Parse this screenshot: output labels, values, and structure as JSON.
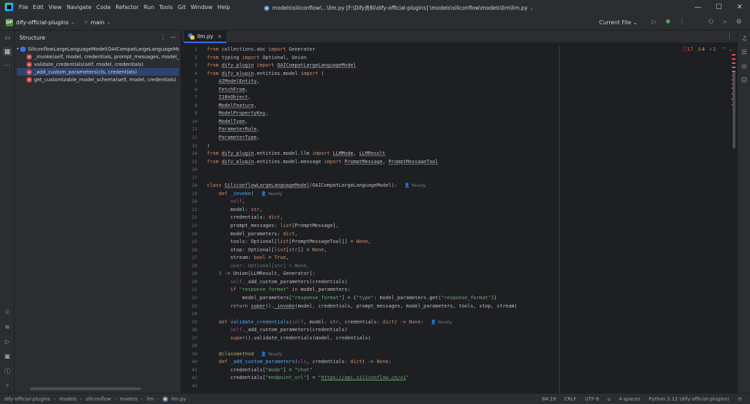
{
  "menu": [
    "File",
    "Edit",
    "View",
    "Navigate",
    "Code",
    "Refactor",
    "Run",
    "Tools",
    "Git",
    "Window",
    "Help"
  ],
  "project": {
    "badge": "DP",
    "name": "dify-official-plugins",
    "branch": "main"
  },
  "file_path": "models\\siliconflow\\...\\llm.py [F:\\Dify资料\\dify-official-plugins] \\models\\siliconflow\\models\\llm\\llm.py",
  "run_config": "Current File",
  "structure": {
    "title": "Structure",
    "items": [
      {
        "label": "SiliconflowLargeLanguageModel(OAICompatLargeLanguageModel)",
        "kind": "class",
        "depth": 0
      },
      {
        "label": "_invoke(self, model, credentials, prompt_messages, model_paramet",
        "kind": "method",
        "depth": 1
      },
      {
        "label": "validate_credentials(self, model, credentials)",
        "kind": "method",
        "depth": 1
      },
      {
        "label": "_add_custom_parameters(cls, credentials)",
        "kind": "method",
        "depth": 1,
        "selected": true
      },
      {
        "label": "get_customizable_model_schema(self, model, credentials)",
        "kind": "method",
        "depth": 1
      }
    ]
  },
  "tab": {
    "label": "llm.py"
  },
  "inspections": {
    "errors": "17",
    "warnings": "4",
    "ok": "1"
  },
  "code": {
    "hint_author": "Yeuoly",
    "line_numbers": [
      "1",
      "2",
      "3",
      "4",
      "5",
      "6",
      "7",
      "8",
      "9",
      "10",
      "11",
      "12",
      "13",
      "14",
      "15",
      "16",
      "17",
      "18",
      "19",
      "20",
      "21",
      "22",
      "23",
      "24",
      "25",
      "26",
      "27",
      "28",
      "29",
      "30",
      "31",
      "32",
      "33",
      "34",
      "35",
      "36",
      "37",
      "38",
      "39",
      "40",
      "41",
      "42",
      "43"
    ],
    "url": "https://api.siliconflow.cn/v1"
  },
  "statusbar": {
    "crumbs": [
      "dify-official-plugins",
      "models",
      "siliconflow",
      "models",
      "llm",
      "llm.py"
    ],
    "position": "84:19",
    "line_sep": "CRLF",
    "encoding": "UTF-8",
    "indent": "4 spaces",
    "interpreter": "Python 3.12 (dify-official-plugins)"
  }
}
